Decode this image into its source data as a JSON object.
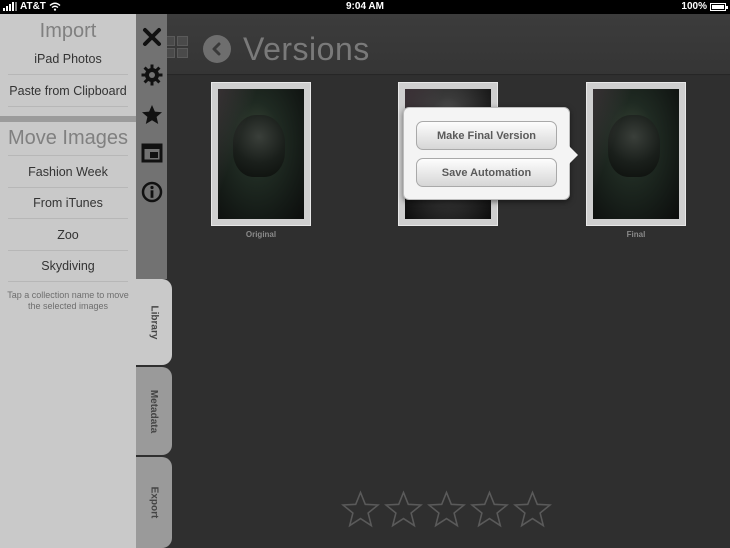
{
  "status_bar": {
    "carrier": "AT&T",
    "time": "9:04 AM",
    "battery": "100%"
  },
  "header": {
    "title": "Versions"
  },
  "drawer": {
    "import_title": "Import",
    "import_items": [
      "iPad Photos",
      "Paste from Clipboard"
    ],
    "move_title": "Move Images",
    "collections": [
      "Fashion Week",
      "From iTunes",
      "Zoo",
      "Skydiving"
    ],
    "hint": "Tap a collection name to move the selected images"
  },
  "tabs": {
    "library": "Library",
    "metadata": "Metadata",
    "export": "Export"
  },
  "thumbnails": {
    "original_label": "Original",
    "final_label": "Final"
  },
  "popover": {
    "make_final": "Make Final Version",
    "save_automation": "Save Automation"
  },
  "rating": {
    "max_stars": 5,
    "value": 0
  },
  "icons": {
    "strip": [
      "close-icon",
      "gear-icon",
      "star-icon",
      "window-icon",
      "info-icon"
    ]
  },
  "colors": {
    "background": "#2f2f2f",
    "drawer": "#c9c9c9",
    "icon_strip": "#727272",
    "title": "#7a7a7a"
  }
}
